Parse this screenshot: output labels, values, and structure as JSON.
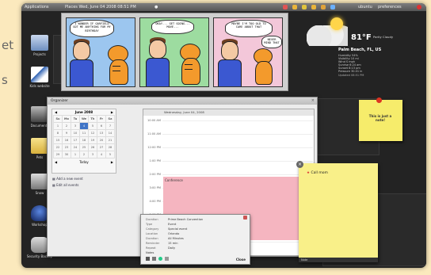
{
  "background_text": {
    "line1": "et",
    "line2": "s"
  },
  "topbar": {
    "left_label": "Applications",
    "center_label": "Places  Wed, June 04 2008  08:51 PM",
    "user": "ubuntu",
    "right_label": "preferences"
  },
  "desktop_icons": [
    {
      "label": "Projects",
      "icon": "folder-icon"
    },
    {
      "label": "Kids website",
      "icon": "document-icon"
    },
    {
      "label": "Documents",
      "icon": "drive-icon"
    },
    {
      "label": "Pets",
      "icon": "folder-icon"
    },
    {
      "label": "Snow",
      "icon": "folder-icon"
    },
    {
      "label": "Workshop",
      "icon": "bottle-icon"
    },
    {
      "label": "Security Backup",
      "icon": "drive-icon"
    }
  ],
  "comic": {
    "panel1": "I WONDER IF GARFIELD GOT ME ANYTHING FOR MY BIRTHDAY",
    "panel2": "OKAY... GET GOING... MOVE...",
    "panel3_a": "MAYBE I'M TOO OLD TO CARE ABOUT THAT",
    "panel3_b": "NEVER MIND THAT"
  },
  "weather": {
    "temp": "81°F",
    "condition": "Partly Cloudy",
    "location": "Palm Beach, FL, US",
    "rows": [
      {
        "k": "Humidity",
        "v": "54%"
      },
      {
        "k": "Visibility",
        "v": "10 mi"
      },
      {
        "k": "Wind",
        "v": "S mph"
      },
      {
        "k": "Sunrise",
        "v": "6:24 am"
      },
      {
        "k": "Sunset",
        "v": "8:13 pm"
      },
      {
        "k": "Pressure",
        "v": "30.01 in"
      }
    ],
    "footer": "Updated 08:51 PM"
  },
  "calendar": {
    "window_title": "Organizer",
    "month": "June 2008",
    "day_header": "Wednesday, June 04, 2008",
    "weekdays": [
      "Su",
      "Mo",
      "Tu",
      "We",
      "Th",
      "Fr",
      "Sa"
    ],
    "weeks": [
      [
        "1",
        "2",
        "3",
        "4",
        "5",
        "6",
        "7"
      ],
      [
        "8",
        "9",
        "10",
        "11",
        "12",
        "13",
        "14"
      ],
      [
        "15",
        "16",
        "17",
        "18",
        "19",
        "20",
        "21"
      ],
      [
        "22",
        "23",
        "24",
        "25",
        "26",
        "27",
        "28"
      ],
      [
        "29",
        "30",
        "1",
        "2",
        "3",
        "4",
        "5"
      ]
    ],
    "selected_day": "4",
    "today_label": "Today",
    "links": [
      "Add a new event",
      "Edit all events"
    ],
    "hours": [
      "10:00 AM",
      "11:00 AM",
      "12:00 PM",
      "1:00 PM",
      "2:00 PM",
      "3:00 PM",
      "4:00 PM",
      "5:00 PM",
      "6:00 PM",
      "7:00 PM"
    ],
    "event_title": "Conference"
  },
  "popup": {
    "rows": [
      {
        "k": "Duration",
        "v": "Prime Beach Convention"
      },
      {
        "k": "Type",
        "v": "Event"
      },
      {
        "k": "Category",
        "v": "Special event"
      },
      {
        "k": "Location",
        "v": "Orlando"
      },
      {
        "k": "Duration",
        "v": "All Minutes"
      },
      {
        "k": "Reminder",
        "v": "15 min"
      },
      {
        "k": "Repeat",
        "v": "Daily"
      }
    ],
    "notes_label": "Notes",
    "close_label": "Close"
  },
  "sticky1": {
    "text": "This is just a note!"
  },
  "sticky2": {
    "title": "Call mom",
    "footer": "Note"
  }
}
